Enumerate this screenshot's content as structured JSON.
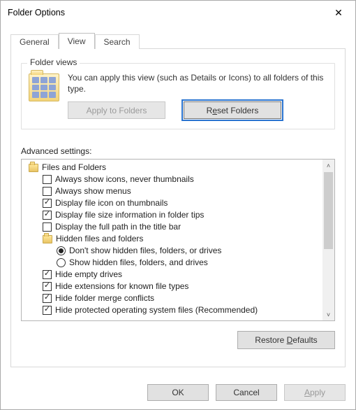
{
  "window": {
    "title": "Folder Options"
  },
  "tabs": {
    "general": "General",
    "view": "View",
    "search": "Search",
    "active": "view"
  },
  "folder_views": {
    "group_title": "Folder views",
    "description": "You can apply this view (such as Details or Icons) to all folders of this type.",
    "apply_btn": {
      "label": "Apply to Folders",
      "enabled": false
    },
    "reset_btn": {
      "pre": "R",
      "mn": "e",
      "post": "set Folders",
      "enabled": true
    }
  },
  "advanced": {
    "label": "Advanced settings:",
    "root_label": "Files and Folders",
    "items": [
      {
        "type": "checkbox",
        "checked": false,
        "label": "Always show icons, never thumbnails"
      },
      {
        "type": "checkbox",
        "checked": false,
        "label": "Always show menus"
      },
      {
        "type": "checkbox",
        "checked": true,
        "label": "Display file icon on thumbnails"
      },
      {
        "type": "checkbox",
        "checked": true,
        "label": "Display file size information in folder tips"
      },
      {
        "type": "checkbox",
        "checked": false,
        "label": "Display the full path in the title bar"
      },
      {
        "type": "folder",
        "label": "Hidden files and folders"
      },
      {
        "type": "radio",
        "selected": true,
        "label": "Don't show hidden files, folders, or drives"
      },
      {
        "type": "radio",
        "selected": false,
        "label": "Show hidden files, folders, and drives"
      },
      {
        "type": "checkbox",
        "checked": true,
        "label": "Hide empty drives"
      },
      {
        "type": "checkbox",
        "checked": true,
        "label": "Hide extensions for known file types"
      },
      {
        "type": "checkbox",
        "checked": true,
        "label": "Hide folder merge conflicts"
      },
      {
        "type": "checkbox",
        "checked": true,
        "label": "Hide protected operating system files (Recommended)"
      }
    ],
    "restore_defaults": {
      "pre": "Restore ",
      "mn": "D",
      "post": "efaults"
    }
  },
  "dialog_buttons": {
    "ok": "OK",
    "cancel": "Cancel",
    "apply": {
      "mn": "A",
      "post": "pply",
      "enabled": false
    }
  }
}
